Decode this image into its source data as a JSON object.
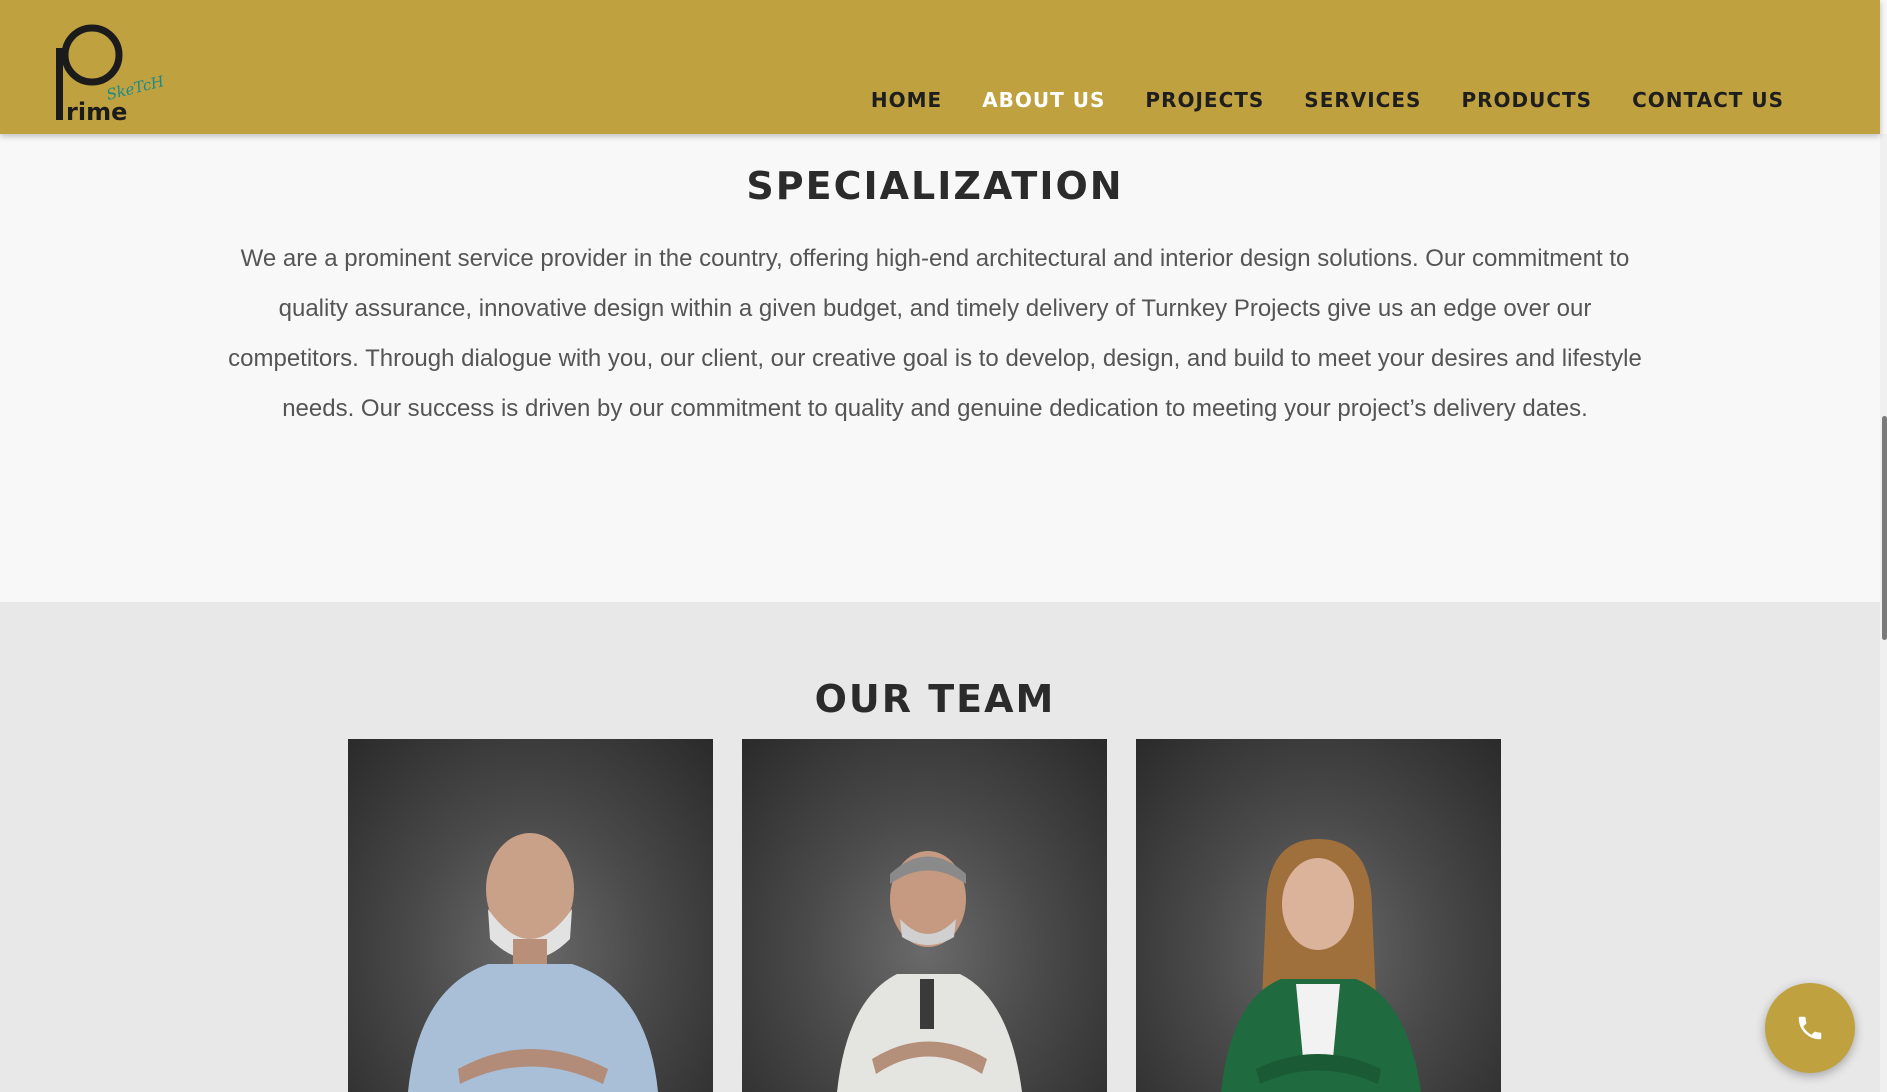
{
  "brand": {
    "logo_main": "rime",
    "logo_script": "SkeTcH",
    "accent_color": "#bfa23f"
  },
  "nav": {
    "items": [
      {
        "label": "HOME",
        "active": false
      },
      {
        "label": "ABOUT US",
        "active": true
      },
      {
        "label": "PROJECTS",
        "active": false
      },
      {
        "label": "SERVICES",
        "active": false
      },
      {
        "label": "PRODUCTS",
        "active": false
      },
      {
        "label": "CONTACT US",
        "active": false
      }
    ]
  },
  "specialization": {
    "title": "SPECIALIZATION",
    "body": "We are a prominent service provider in the country, offering high-end architectural and interior design solutions. Our commitment to quality assurance, innovative design within a given budget, and timely delivery of Turnkey Projects give us an edge over our competitors. Through dialogue with you, our client, our creative goal is to develop, design, and build to meet your desires and lifestyle needs. Our success is driven by our commitment to quality and genuine dedication to meeting your project’s delivery dates."
  },
  "team": {
    "title": "OUR TEAM",
    "members": [
      {
        "photo": "team-member-photo-1"
      },
      {
        "photo": "team-member-photo-2"
      },
      {
        "photo": "team-member-photo-3"
      }
    ]
  },
  "floating": {
    "call_icon": "phone-icon"
  }
}
